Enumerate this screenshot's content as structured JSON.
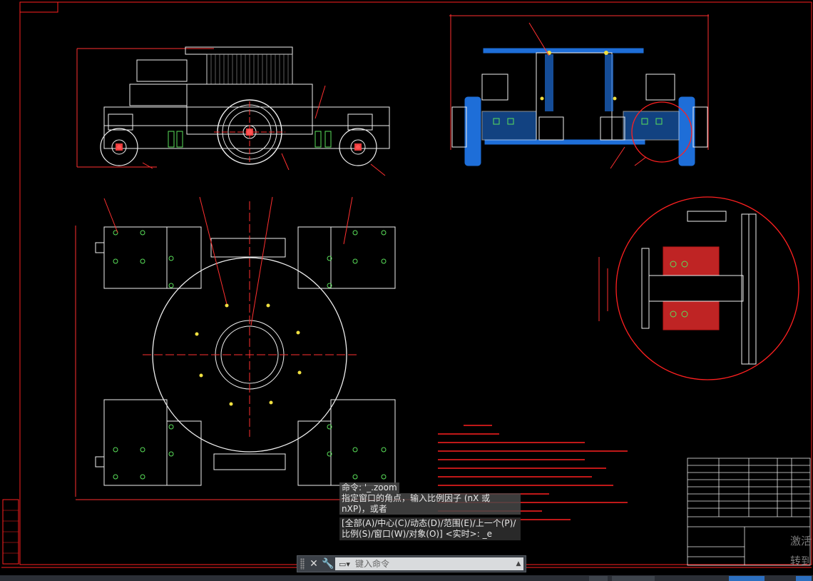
{
  "command_line": {
    "history": [
      "命令: '_.zoom",
      "指定窗口的角点，输入比例因子 (nX 或 nXP)，或者",
      "[全部(A)/中心(C)/动态(D)/范围(E)/上一个(P)/比例(S)/窗口(W)/对象(O)] <实时>: _e"
    ],
    "input_placeholder": "键入命令"
  },
  "watermark": {
    "line1": "激活",
    "line2": "转到"
  },
  "colors": {
    "background": "#000000",
    "frame_red": "#ff2020",
    "dimension_red": "#ff3030",
    "outline_white": "#f0f0f0",
    "part_blue": "#1e6ed8",
    "green_marks": "#5ae05a",
    "yellow_marks": "#f0e040"
  }
}
